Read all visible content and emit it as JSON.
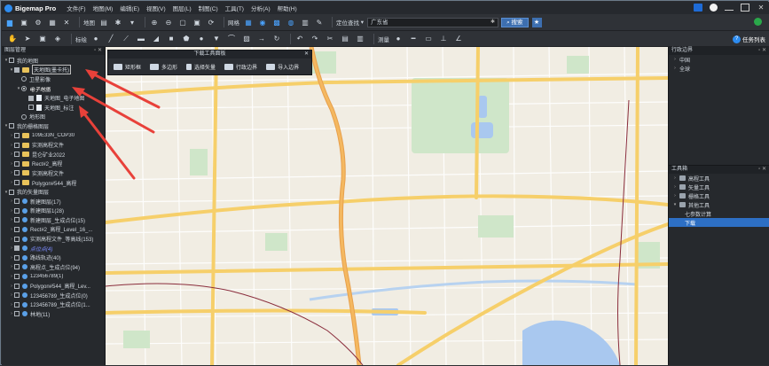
{
  "titlebar": {
    "app_title": "Bigemap Pro",
    "menus": [
      "文件(F)",
      "地图(M)",
      "编辑(E)",
      "视图(V)",
      "图层(L)",
      "制图(C)",
      "工具(T)",
      "分析(A)",
      "帮助(H)"
    ]
  },
  "toolbar1": {
    "map_label": "地图",
    "grid_label": "网格",
    "locate_dropdown": "定位查找",
    "search_value": "广东省",
    "search_button": "搜索"
  },
  "toolbar2": {
    "annotate_label": "标绘",
    "measure_label": "测量",
    "task_list_label": "任务列表"
  },
  "left_panel": {
    "title": "图层管理",
    "items": [
      {
        "label": "我的地图"
      },
      {
        "label": "天地图(墨卡托)"
      },
      {
        "label": "卫星影像"
      },
      {
        "label": "电子地图"
      },
      {
        "label": "天地图_电子地图"
      },
      {
        "label": "天地图_标注"
      },
      {
        "label": "地形图"
      },
      {
        "label": "我的栅格图层"
      },
      {
        "label": "109E33N_COP30"
      },
      {
        "label": "实测高程文件"
      },
      {
        "label": "昆仑矿业2022"
      },
      {
        "label": "Rect#2_高程"
      },
      {
        "label": "实测高程文件"
      },
      {
        "label": "Polygon#544_高程"
      },
      {
        "label": "我的矢量图层"
      },
      {
        "label": "新建图层(17)"
      },
      {
        "label": "新建图层1(28)"
      },
      {
        "label": "新建图层_生成点位(15)"
      },
      {
        "label": "Rect#2_高程_Level_16_..."
      },
      {
        "label": "实测高程文件_等高线(153)"
      },
      {
        "label": "点位点(4)"
      },
      {
        "label": "路线轨迹(40)"
      },
      {
        "label": "高程点_生成点位(94)"
      },
      {
        "label": "123456789(1)"
      },
      {
        "label": "Polygon#544_高程_Lev..."
      },
      {
        "label": "123456789_生成点位(0)"
      },
      {
        "label": "123456789_生成点位(1..."
      },
      {
        "label": "林地(11)"
      }
    ]
  },
  "float_toolbar": {
    "title": "下载工具面板",
    "items": [
      "矩形框",
      "多边形",
      "选择矢量",
      "行政边界",
      "导入边界"
    ]
  },
  "right_top": {
    "title": "行政边界",
    "items": [
      "中国",
      "全球"
    ]
  },
  "right_bottom": {
    "title": "工具箱",
    "items": [
      "高程工具",
      "矢量工具",
      "栅格工具",
      "其他工具"
    ],
    "sub_items": [
      "七参数计算",
      "下载"
    ]
  }
}
